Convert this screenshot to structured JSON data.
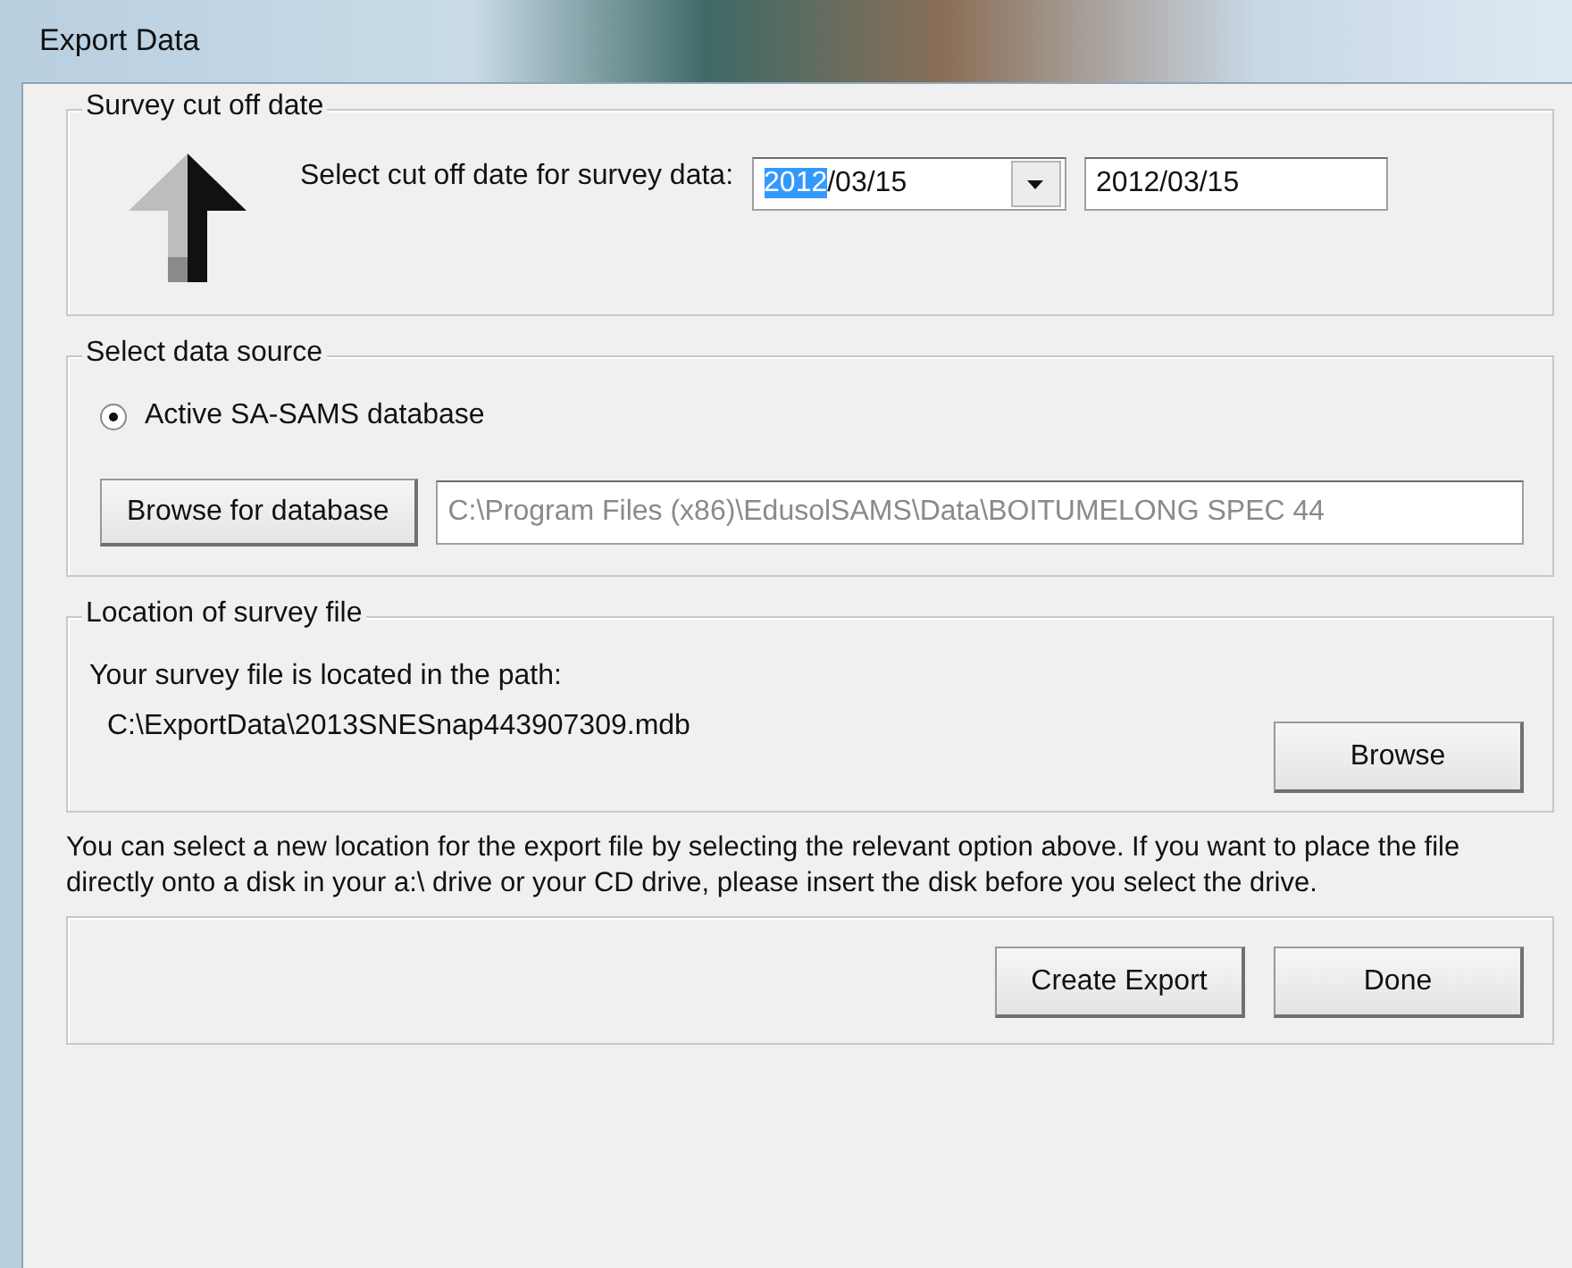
{
  "window": {
    "title": "Export Data"
  },
  "cutoff_group": {
    "legend": "Survey cut off date",
    "prompt": "Select cut off date for survey data:",
    "date_combo": {
      "highlighted": "2012",
      "rest": "/03/15"
    },
    "date_field": {
      "value": "2012/03/15"
    }
  },
  "source_group": {
    "legend": "Select data source",
    "radio": {
      "label": "Active SA-SAMS database",
      "checked": true
    },
    "browse_button": "Browse for database",
    "path_field": {
      "value": "C:\\Program Files (x86)\\EdusolSAMS\\Data\\BOITUMELONG SPEC 44",
      "disabled": true
    }
  },
  "location_group": {
    "legend": "Location of survey file",
    "caption": "Your survey file is located in the path:",
    "path": "C:\\ExportData\\2013SNESnap443907309.mdb",
    "browse_button": "Browse"
  },
  "note": "You can select a new location for the export file by selecting the relevant option above. If you want to place the file directly onto a disk in your a:\\ drive or your CD drive, please insert the disk before you select the drive.",
  "buttons": [
    "Create Export",
    "Done"
  ]
}
